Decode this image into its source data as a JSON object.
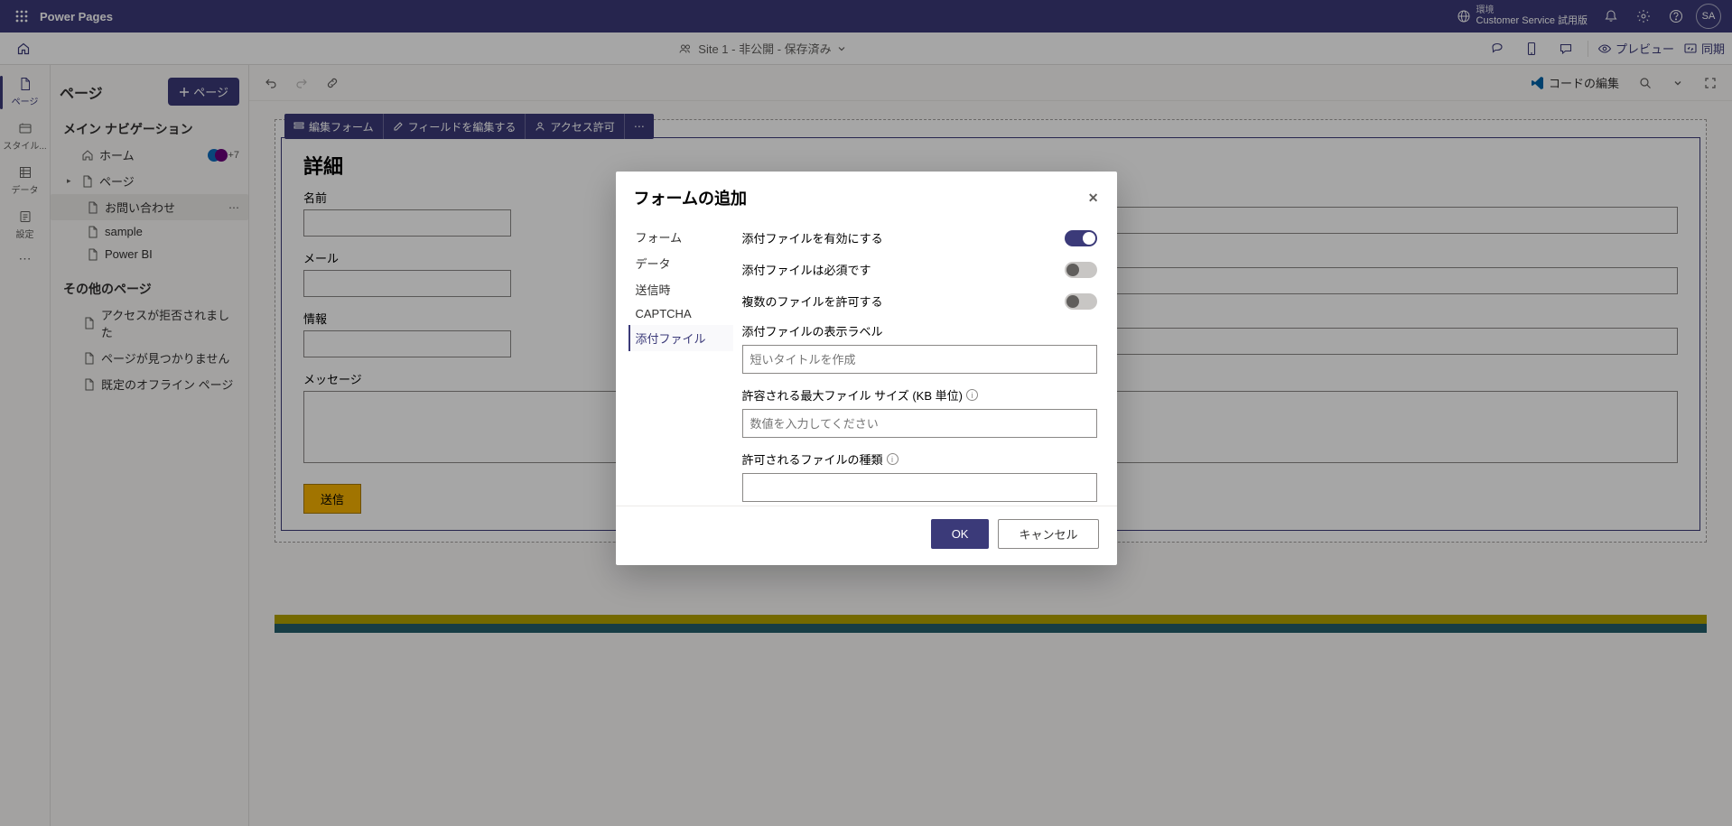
{
  "brand": "Power Pages",
  "environment": {
    "label": "環境",
    "name": "Customer Service 試用版"
  },
  "avatar": "SA",
  "subbar": {
    "site_label": "Site 1 - 非公開 - 保存済み",
    "preview": "プレビュー",
    "sync": "同期"
  },
  "rail": {
    "page": "ページ",
    "style": "スタイル...",
    "data": "データ",
    "setup": "設定"
  },
  "sidepanel": {
    "title": "ページ",
    "add_button": "ページ",
    "section_main": "メイン ナビゲーション",
    "home": "ホーム",
    "home_badge": "+7",
    "page_item": "ページ",
    "contact": "お問い合わせ",
    "sample": "sample",
    "powerbi": "Power BI",
    "section_other": "その他のページ",
    "access_denied": "アクセスが拒否されました",
    "not_found": "ページが見つかりません",
    "offline": "既定のオフライン ページ"
  },
  "content_toolbar": {
    "code_edit": "コードの編集"
  },
  "pill": {
    "edit_form": "編集フォーム",
    "edit_fields": "フィールドを編集する",
    "permissions": "アクセス許可"
  },
  "form_canvas": {
    "heading": "詳細",
    "name": "名前",
    "email": "メール",
    "info": "情報",
    "message": "メッセージ",
    "submit": "送信"
  },
  "modal": {
    "title": "フォームの追加",
    "nav": {
      "form": "フォーム",
      "data": "データ",
      "on_submit": "送信時",
      "captcha": "CAPTCHA",
      "attachments": "添付ファイル"
    },
    "fields": {
      "enable_attach": "添付ファイルを有効にする",
      "attach_required": "添付ファイルは必須です",
      "allow_multiple": "複数のファイルを許可する",
      "display_label": "添付ファイルの表示ラベル",
      "display_label_placeholder": "短いタイトルを作成",
      "max_size": "許容される最大ファイル サイズ (KB 単位)",
      "max_size_placeholder": "数値を入力してください",
      "allowed_types": "許可されるファイルの種類"
    },
    "toggles": {
      "enable_attach": true,
      "attach_required": false,
      "allow_multiple": false
    },
    "ok": "OK",
    "cancel": "キャンセル"
  }
}
